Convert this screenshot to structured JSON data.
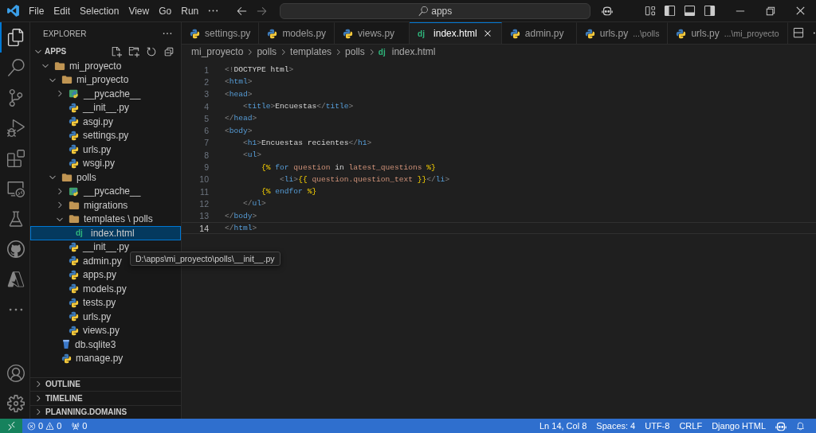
{
  "menu": [
    "File",
    "Edit",
    "Selection",
    "View",
    "Go",
    "Run"
  ],
  "search": {
    "value": "apps"
  },
  "activity": [
    {
      "kind": "files",
      "selected": true
    },
    {
      "kind": "search",
      "selected": false
    },
    {
      "kind": "git",
      "selected": false
    },
    {
      "kind": "debug",
      "selected": false
    },
    {
      "kind": "extensions",
      "selected": false
    },
    {
      "kind": "remote",
      "selected": false
    },
    {
      "kind": "testing",
      "selected": false
    },
    {
      "kind": "github",
      "selected": false
    },
    {
      "kind": "azure",
      "selected": false
    },
    {
      "kind": "more",
      "selected": false
    }
  ],
  "sidebar": {
    "title": "EXPLORER",
    "root": {
      "label": "APPS",
      "expanded": true,
      "children": [
        {
          "name": "mi_proyecto",
          "kind": "folder",
          "expanded": true,
          "selected": false,
          "children": [
            {
              "name": "mi_proyecto",
              "kind": "folder",
              "expanded": true,
              "selected": false,
              "children": [
                {
                  "name": "__pycache__",
                  "kind": "pycache",
                  "expanded": false,
                  "selected": false
                },
                {
                  "name": "__init__.py",
                  "kind": "python",
                  "selected": false
                },
                {
                  "name": "asgi.py",
                  "kind": "python",
                  "selected": false
                },
                {
                  "name": "settings.py",
                  "kind": "python",
                  "selected": false
                },
                {
                  "name": "urls.py",
                  "kind": "python",
                  "selected": false
                },
                {
                  "name": "wsgi.py",
                  "kind": "python",
                  "selected": false
                }
              ]
            },
            {
              "name": "polls",
              "kind": "folder",
              "expanded": true,
              "selected": false,
              "children": [
                {
                  "name": "__pycache__",
                  "kind": "pycache",
                  "expanded": false,
                  "selected": false
                },
                {
                  "name": "migrations",
                  "kind": "folder",
                  "expanded": false,
                  "selected": false
                },
                {
                  "name": "templates \\ polls",
                  "kind": "folder",
                  "expanded": true,
                  "selected": false,
                  "children": [
                    {
                      "name": "index.html",
                      "kind": "django",
                      "icon_label": "dj",
                      "selected": true
                    }
                  ]
                },
                {
                  "name": "__init__.py",
                  "kind": "python",
                  "selected": false
                },
                {
                  "name": "admin.py",
                  "kind": "python",
                  "selected": false
                },
                {
                  "name": "apps.py",
                  "kind": "python",
                  "selected": false
                },
                {
                  "name": "models.py",
                  "kind": "python",
                  "selected": false
                },
                {
                  "name": "tests.py",
                  "kind": "python",
                  "selected": false
                },
                {
                  "name": "urls.py",
                  "kind": "python",
                  "selected": false
                },
                {
                  "name": "views.py",
                  "kind": "python",
                  "selected": false
                }
              ]
            },
            {
              "name": "db.sqlite3",
              "kind": "db",
              "selected": false
            },
            {
              "name": "manage.py",
              "kind": "python",
              "selected": false
            }
          ]
        }
      ]
    },
    "sections": [
      {
        "label": "OUTLINE",
        "expanded": false
      },
      {
        "label": "TIMELINE",
        "expanded": false
      },
      {
        "label": "PLANNING.DOMAINS",
        "expanded": false
      }
    ]
  },
  "tooltip": "D:\\apps\\mi_proyecto\\polls\\__init__.py",
  "tabs": [
    {
      "label": "settings.py",
      "kind": "python",
      "selected": false
    },
    {
      "label": "models.py",
      "kind": "python",
      "selected": false
    },
    {
      "label": "views.py",
      "kind": "python",
      "selected": false
    },
    {
      "label": "index.html",
      "kind": "django",
      "icon_label": "dj",
      "selected": true
    },
    {
      "label": "admin.py",
      "kind": "python",
      "selected": false
    },
    {
      "label": "urls.py",
      "description": "...\\polls",
      "kind": "python",
      "selected": false
    },
    {
      "label": "urls.py",
      "description": "...\\mi_proyecto",
      "kind": "python",
      "selected": false
    }
  ],
  "breadcrumbs": [
    {
      "label": "mi_proyecto"
    },
    {
      "label": "polls"
    },
    {
      "label": "templates"
    },
    {
      "label": "polls"
    },
    {
      "label": "index.html",
      "icon_label": "dj"
    }
  ],
  "code": [
    {
      "number": "1",
      "current": false,
      "tokens": [
        {
          "kind": "punct",
          "t": "<!"
        },
        {
          "kind": "text",
          "t": "DOCTYPE html"
        },
        {
          "kind": "punct",
          "t": ">"
        }
      ]
    },
    {
      "number": "2",
      "current": false,
      "tokens": [
        {
          "kind": "punct",
          "t": "<"
        },
        {
          "kind": "tag",
          "t": "html"
        },
        {
          "kind": "punct",
          "t": ">"
        }
      ]
    },
    {
      "number": "3",
      "current": false,
      "tokens": [
        {
          "kind": "punct",
          "t": "<"
        },
        {
          "kind": "tag",
          "t": "head"
        },
        {
          "kind": "punct",
          "t": ">"
        }
      ]
    },
    {
      "number": "4",
      "current": false,
      "tokens": [
        {
          "kind": "punct",
          "t": "    <"
        },
        {
          "kind": "tag",
          "t": "title"
        },
        {
          "kind": "punct",
          "t": ">"
        },
        {
          "kind": "text",
          "t": "Encuestas"
        },
        {
          "kind": "punct",
          "t": "</"
        },
        {
          "kind": "tag",
          "t": "title"
        },
        {
          "kind": "punct",
          "t": ">"
        }
      ]
    },
    {
      "number": "5",
      "current": false,
      "tokens": [
        {
          "kind": "punct",
          "t": "</"
        },
        {
          "kind": "tag",
          "t": "head"
        },
        {
          "kind": "punct",
          "t": ">"
        }
      ]
    },
    {
      "number": "6",
      "current": false,
      "tokens": [
        {
          "kind": "punct",
          "t": "<"
        },
        {
          "kind": "tag",
          "t": "body"
        },
        {
          "kind": "punct",
          "t": ">"
        }
      ]
    },
    {
      "number": "7",
      "current": false,
      "tokens": [
        {
          "kind": "punct",
          "t": "    <"
        },
        {
          "kind": "tag",
          "t": "h1"
        },
        {
          "kind": "punct",
          "t": ">"
        },
        {
          "kind": "text",
          "t": "Encuestas recientes"
        },
        {
          "kind": "punct",
          "t": "</"
        },
        {
          "kind": "tag",
          "t": "h1"
        },
        {
          "kind": "punct",
          "t": ">"
        }
      ]
    },
    {
      "number": "8",
      "current": false,
      "tokens": [
        {
          "kind": "punct",
          "t": "    <"
        },
        {
          "kind": "tag",
          "t": "ul"
        },
        {
          "kind": "punct",
          "t": ">"
        }
      ]
    },
    {
      "number": "9",
      "current": false,
      "tokens": [
        {
          "kind": "delim",
          "t": "        {%"
        },
        {
          "kind": "kw",
          "t": " for"
        },
        {
          "kind": "var",
          "t": " question"
        },
        {
          "kind": "text",
          "t": " in"
        },
        {
          "kind": "var",
          "t": " latest_questions"
        },
        {
          "kind": "delim",
          "t": " %}"
        }
      ]
    },
    {
      "number": "10",
      "current": false,
      "tokens": [
        {
          "kind": "punct",
          "t": "            <"
        },
        {
          "kind": "tag",
          "t": "li"
        },
        {
          "kind": "punct",
          "t": ">"
        },
        {
          "kind": "delim",
          "t": "{{"
        },
        {
          "kind": "var",
          "t": " question.question_text"
        },
        {
          "kind": "delim",
          "t": " }}"
        },
        {
          "kind": "punct",
          "t": "</"
        },
        {
          "kind": "tag",
          "t": "li"
        },
        {
          "kind": "punct",
          "t": ">"
        }
      ]
    },
    {
      "number": "11",
      "current": false,
      "tokens": [
        {
          "kind": "delim",
          "t": "        {%"
        },
        {
          "kind": "kw",
          "t": " endfor"
        },
        {
          "kind": "delim",
          "t": " %}"
        }
      ]
    },
    {
      "number": "12",
      "current": false,
      "tokens": [
        {
          "kind": "punct",
          "t": "    </"
        },
        {
          "kind": "tag",
          "t": "ul"
        },
        {
          "kind": "punct",
          "t": ">"
        }
      ]
    },
    {
      "number": "13",
      "current": false,
      "tokens": [
        {
          "kind": "punct",
          "t": "</"
        },
        {
          "kind": "tag",
          "t": "body"
        },
        {
          "kind": "punct",
          "t": ">"
        }
      ]
    },
    {
      "number": "14",
      "current": true,
      "tokens": [
        {
          "kind": "punct",
          "t": "</"
        },
        {
          "kind": "tag",
          "t": "html"
        },
        {
          "kind": "punct",
          "t": ">"
        }
      ]
    }
  ],
  "status": {
    "errors": "0",
    "warnings": "0",
    "ports": "0",
    "right": [
      "Ln 14, Col 8",
      "Spaces: 4",
      "UTF-8",
      "CRLF",
      "Django HTML"
    ]
  }
}
